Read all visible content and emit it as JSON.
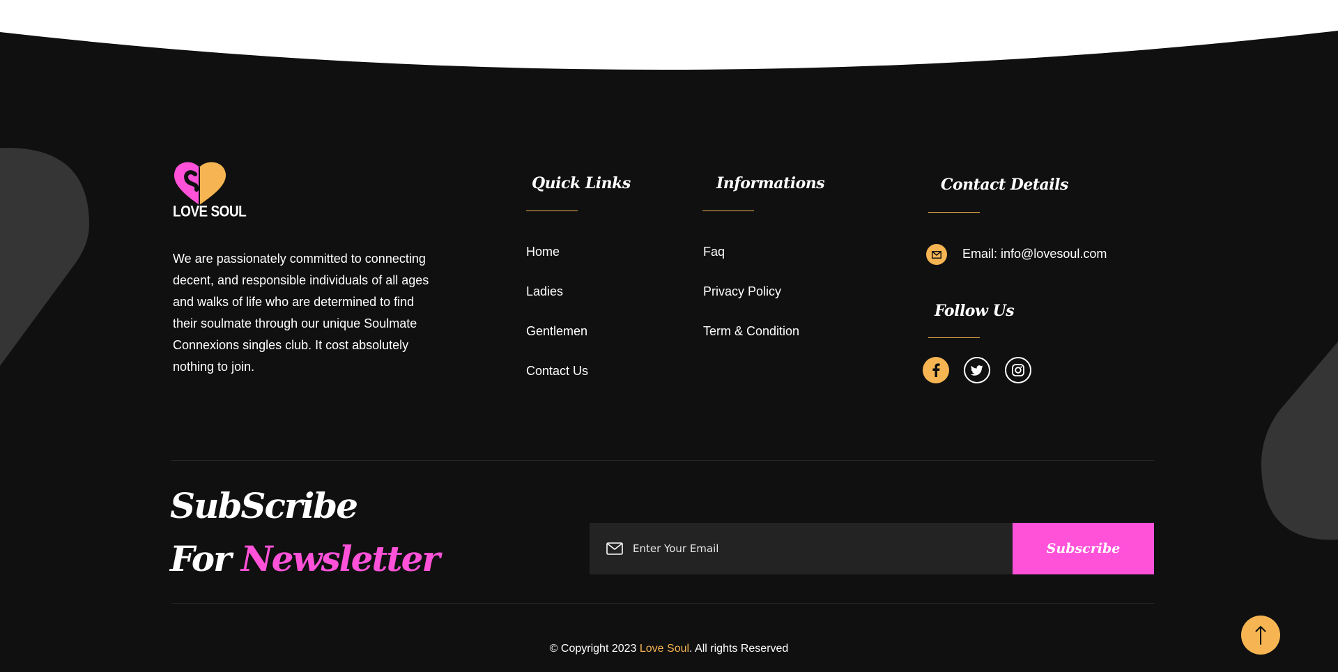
{
  "brand": {
    "logo_text": "LOVE SOUL",
    "about": "We are passionately committed to connecting decent, and responsible individuals of all ages and walks of life who are determined to find their soulmate through our unique Soulmate Connexions singles club. It cost absolutely nothing to join."
  },
  "quick_links": {
    "title": "Quick Links",
    "items": [
      {
        "label": "Home"
      },
      {
        "label": "Ladies"
      },
      {
        "label": "Gentlemen"
      },
      {
        "label": "Contact Us"
      }
    ]
  },
  "informations": {
    "title": "Informations",
    "items": [
      {
        "label": "Faq"
      },
      {
        "label": "Privacy Policy"
      },
      {
        "label": "Term & Condition"
      }
    ]
  },
  "contact": {
    "title": "Contact Details",
    "email_text": "Email: info@lovesoul.com",
    "icon": "envelope-icon"
  },
  "follow": {
    "title": "Follow Us",
    "icons": [
      "facebook-icon",
      "twitter-icon",
      "instagram-icon"
    ]
  },
  "newsletter": {
    "line1": "SubScribe",
    "line2_prefix": "For",
    "line2_accent": "Newsletter",
    "placeholder": "Enter Your Email",
    "button_label": "Subscribe"
  },
  "copyright": {
    "prefix": "© Copyright 2023 ",
    "brand": "Love Soul",
    "suffix": ". All rights Reserved"
  },
  "colors": {
    "background": "#101010",
    "accent_orange": "#f6b552",
    "accent_pink": "#ff52d9",
    "input_bg": "#232323"
  }
}
